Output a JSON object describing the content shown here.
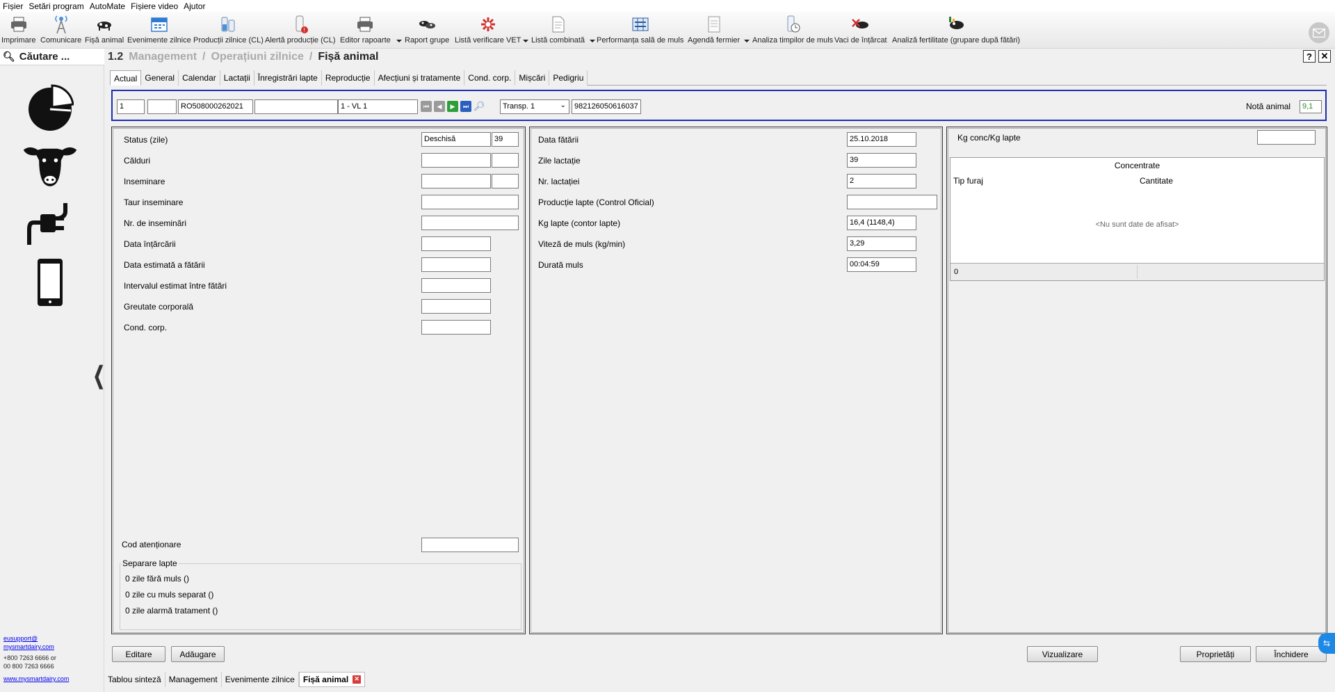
{
  "menu": [
    "Fișier",
    "Setări program",
    "AutoMate",
    "Fișiere video",
    "Ajutor"
  ],
  "toolbar": [
    {
      "label": "Imprimare",
      "icon": "printer-icon"
    },
    {
      "label": "Comunicare",
      "icon": "antenna-icon"
    },
    {
      "label": "Fișă animal",
      "icon": "cow-card-icon"
    },
    {
      "label": "Evenimente zilnice",
      "icon": "calendar-icon"
    },
    {
      "label": "Producții zilnice (CL)",
      "icon": "milk-bottles-icon"
    },
    {
      "label": "Alertă producție (CL)",
      "icon": "milk-alert-icon"
    },
    {
      "label": "Editor rapoarte",
      "icon": "printer-icon"
    },
    {
      "label": "Raport grupe",
      "icon": "cow-group-icon"
    },
    {
      "label": "Listă verificare VET",
      "icon": "vet-icon"
    },
    {
      "label": "Listă combinată",
      "icon": "document-icon"
    },
    {
      "label": "Performanța sală de muls",
      "icon": "parlour-icon"
    },
    {
      "label": "Agendă fermier",
      "icon": "agenda-icon"
    },
    {
      "label": "Analiza timpilor de muls",
      "icon": "timer-bottle-icon"
    },
    {
      "label": "Vaci de înțărcat",
      "icon": "dry-cow-icon"
    },
    {
      "label": "Analiză fertilitate (grupare după fătări)",
      "icon": "fertility-icon"
    }
  ],
  "sidebar": {
    "search_label": "Căutare ...",
    "support_email_1": "eusupport@",
    "support_email_2": "mysmartdairy.com",
    "phone_1": "+800 7263 6666 or",
    "phone_2": "00 800 7263 6666",
    "website": "www.mysmartdairy.com"
  },
  "header": {
    "number": "1.2",
    "crumb1": "Management",
    "crumb2": "Operațiuni zilnice",
    "current": "Fișă animal",
    "help": "?",
    "close": "✕"
  },
  "tabs": [
    "Actual",
    "General",
    "Calendar",
    "Lactații",
    "Înregistrări lapte",
    "Reproducție",
    "Afecțiuni și tratamente",
    "Cond. corp.",
    "Mișcări",
    "Pedigriu"
  ],
  "selector": {
    "animal_no": "1",
    "field2": "",
    "id_number": "RO508000262021",
    "field4": "",
    "group": "1 - VL 1",
    "transponder_label": "Transp. 1",
    "transponder_value": "982126050616037",
    "grade_label": "Notă animal",
    "grade_value": "9,1"
  },
  "left_panel": {
    "status_label": "Status (zile)",
    "status_value": "Deschisă",
    "status_days": "39",
    "heat_label": "Călduri",
    "insem_label": "Inseminare",
    "bull_label": "Taur inseminare",
    "insem_count_label": "Nr. de inseminări",
    "dry_off_label": "Data înțărcării",
    "exp_calving_label": "Data estimată a fătării",
    "exp_interval_label": "Intervalul estimat între fătări",
    "weight_label": "Greutate corporală",
    "bcs_label": "Cond. corp.",
    "attention_label": "Cod atenționare",
    "separation_label": "Separare lapte",
    "sep_line1": "0 zile fără muls ()",
    "sep_line2": "0 zile cu muls separat ()",
    "sep_line3": "0 zile alarmă tratament ()"
  },
  "middle_panel": {
    "calving_date_label": "Data fătării",
    "calving_date_value": "25.10.2018",
    "lact_days_label": "Zile lactație",
    "lact_days_value": "39",
    "lact_no_label": "Nr. lactației",
    "lact_no_value": "2",
    "official_prod_label": "Producție lapte (Control Oficial)",
    "official_prod_value": "",
    "kg_milk_label": "Kg lapte (contor lapte)",
    "kg_milk_value": "16,4 (1148,4)",
    "speed_label": "Viteză de muls (kg/min)",
    "speed_value": "3,29",
    "duration_label": "Durată muls",
    "duration_value": "00:04:59"
  },
  "right_panel": {
    "kg_conc_label": "Kg conc/Kg lapte",
    "kg_conc_value": "",
    "grid_title": "Concentrate",
    "col1": "Tip furaj",
    "col2": "Cantitate",
    "empty_text": "<Nu sunt date de afisat>",
    "footer_value": "0"
  },
  "buttons": {
    "edit": "Editare",
    "add": "Adăugare",
    "view": "Vizualizare",
    "properties": "Proprietăți",
    "close": "Închidere"
  },
  "doc_tabs": [
    "Tablou sinteză",
    "Management",
    "Evenimente zilnice",
    "Fișă animal"
  ]
}
